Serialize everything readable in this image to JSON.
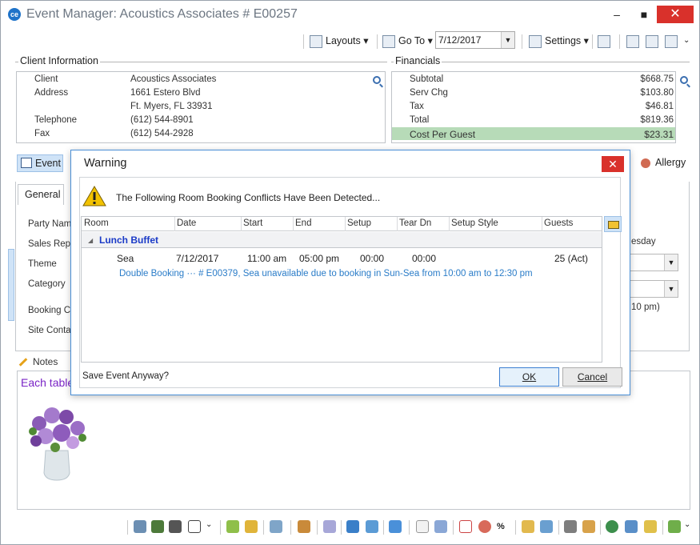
{
  "window": {
    "title": "Event Manager:  Acoustics Associates # E00257",
    "minimize": "–",
    "maximize": "■",
    "close": "✕"
  },
  "toolbar": {
    "layouts": "Layouts",
    "goto": "Go To",
    "date": "7/12/2017",
    "settings": "Settings"
  },
  "client": {
    "heading": "Client Information",
    "rows": [
      {
        "label": "Client",
        "value": "Acoustics Associates"
      },
      {
        "label": "Address",
        "value": "1661 Estero Blvd"
      },
      {
        "label": "",
        "value": "Ft. Myers, FL 33931"
      },
      {
        "label": "Telephone",
        "value": "(612) 544-8901"
      },
      {
        "label": "Fax",
        "value": "(612) 544-2928"
      }
    ]
  },
  "financials": {
    "heading": "Financials",
    "rows": [
      {
        "label": "Subtotal",
        "value": "$668.75"
      },
      {
        "label": "Serv Chg",
        "value": "$103.80"
      },
      {
        "label": "Tax",
        "value": "$46.81"
      },
      {
        "label": "Total",
        "value": "$819.36"
      },
      {
        "label": "Cost Per Guest",
        "value": "$23.31"
      }
    ]
  },
  "tabs": {
    "event": "Event",
    "allergy": "Allergy",
    "general": "General"
  },
  "form": {
    "labels": [
      "Party Nam",
      "Sales Rep",
      "Theme",
      "Category",
      "Booking C",
      "Site Conta"
    ],
    "right_day": "esday",
    "right_time": "10 pm)"
  },
  "notes": {
    "label": "Notes",
    "text": "Each table"
  },
  "dialog": {
    "title": "Warning",
    "close": "✕",
    "message": "The Following Room Booking Conflicts Have Been Detected...",
    "columns": [
      "Room",
      "Date",
      "Start",
      "End",
      "Setup",
      "Tear Dn",
      "Setup Style",
      "Guests"
    ],
    "group": "Lunch Buffet",
    "row": {
      "room": "Sea",
      "date": "7/12/2017",
      "start": "11:00 am",
      "end": "05:00 pm",
      "setup": "00:00",
      "teardn": "00:00",
      "style": "",
      "guests": "25 (Act)"
    },
    "conflict": "Double Booking ···  # E00379, Sea unavailable due to booking in Sun-Sea from 10:00 am to 12:30 pm",
    "question": "Save Event Anyway?",
    "ok": "OK",
    "cancel": "Cancel"
  },
  "colors": {
    "accent": "#1f73c9",
    "close_red": "#d9312b",
    "highlight_green": "#b7dbb8",
    "group_blue": "#1a3ac7",
    "notes_purple": "#7a24c6"
  }
}
